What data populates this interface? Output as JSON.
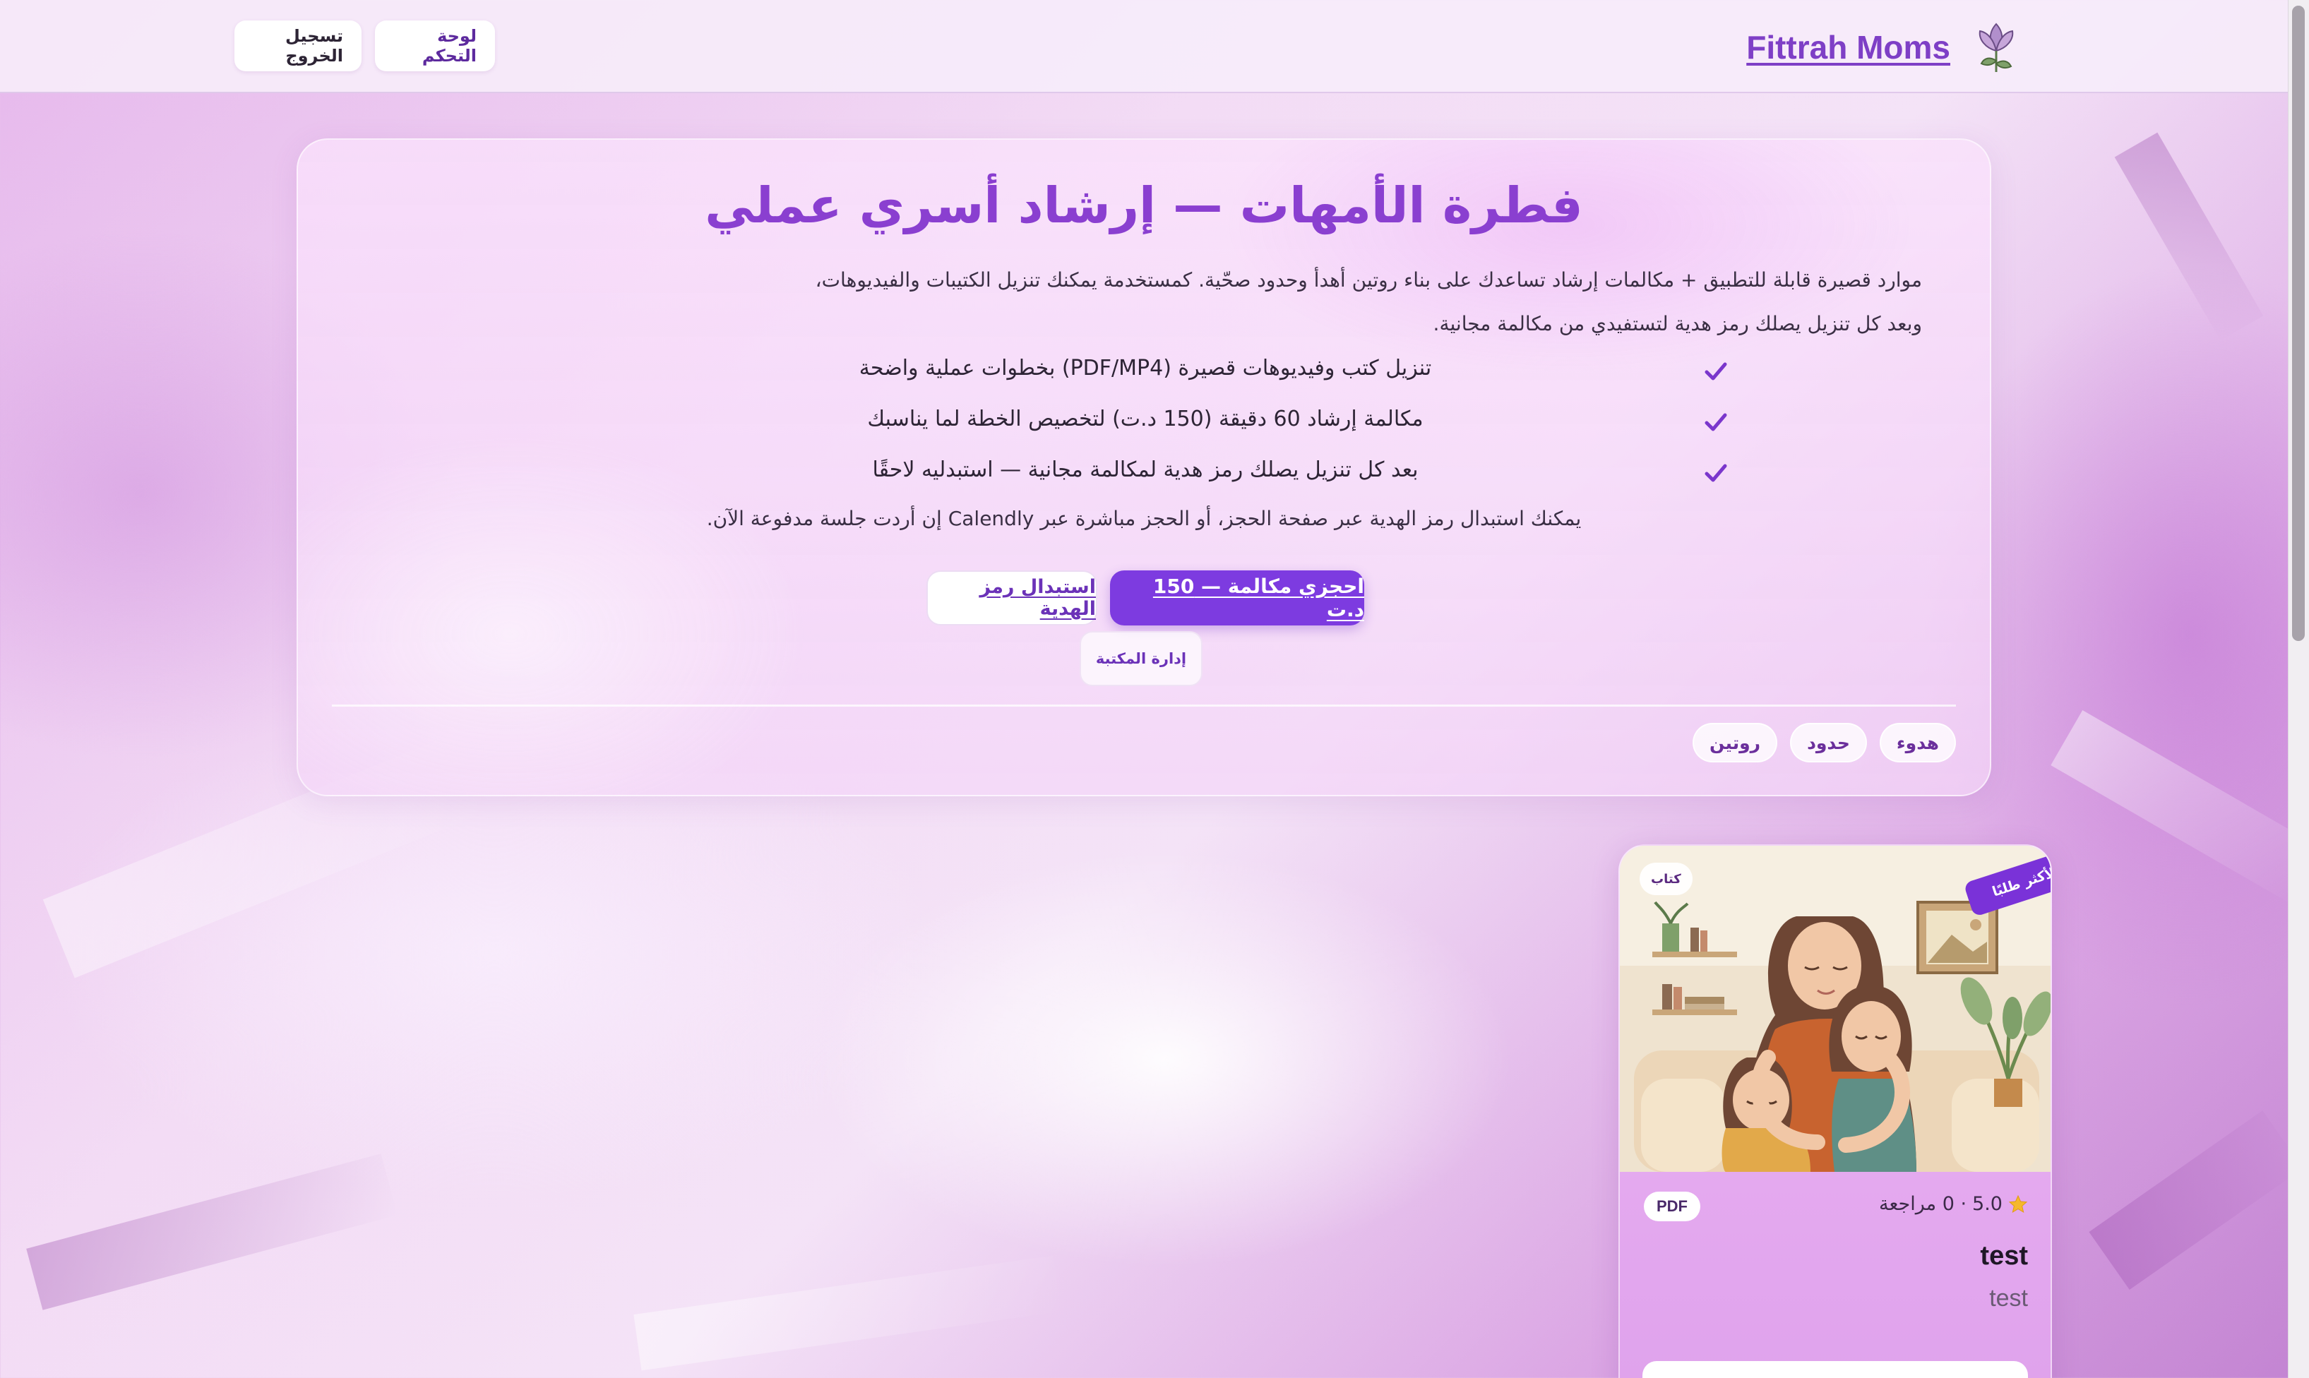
{
  "header": {
    "brand_name": "Fittrah Moms",
    "brand_logo": "lotus-flower-logo",
    "dashboard_label": "لوحة التحكم",
    "logout_label": "تسجيل الخروج"
  },
  "hero": {
    "title": "فطرة الأمهات — إرشاد أسري عملي",
    "description": "موارد قصيرة قابلة للتطبيق + مكالمات إرشاد تساعدك على بناء روتين أهدأ وحدود صحّية. كمستخدمة يمكنك تنزيل الكتيبات والفيديوهات، وبعد كل تنزيل يصلك رمز هدية لتستفيدي من مكالمة مجانية.",
    "features": [
      "تنزيل كتب وفيديوهات قصيرة (PDF/MP4) بخطوات عملية واضحة",
      "مكالمة إرشاد 60 دقيقة (150 د.ت) لتخصيص الخطة لما يناسبك",
      "بعد كل تنزيل يصلك رمز هدية لمكالمة مجانية — استبدليه لاحقًا"
    ],
    "note": "يمكنك استبدال رمز الهدية عبر صفحة الحجز، أو الحجز مباشرة عبر Calendly إن أردت جلسة مدفوعة الآن.",
    "book_call_label": "احجزي مكالمة — 150 د.ت",
    "redeem_gift_label": "استبدال رمز الهدية",
    "manage_library_label": "إدارة المكتبة",
    "tags": [
      "هدوء",
      "حدود",
      "روتين"
    ]
  },
  "product": {
    "type_badge": "كتاب",
    "ribbon": "الأكثر طلبًا",
    "rating": "5.0",
    "reviews": "· 0 مراجعة",
    "format": "PDF",
    "title": "test",
    "description": "test"
  },
  "colors": {
    "accent": "#7d3be0",
    "title": "#8a3fd0",
    "check": "#7a36cc"
  }
}
